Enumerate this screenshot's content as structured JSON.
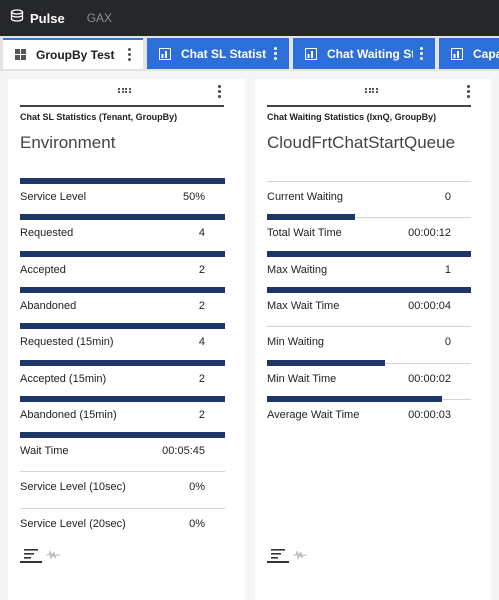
{
  "app": {
    "name": "Pulse",
    "nav": [
      "GAX"
    ]
  },
  "tabs": [
    {
      "label": "GroupBy Test",
      "active": true
    },
    {
      "label": "Chat SL Statistic…",
      "active": false
    },
    {
      "label": "Chat Waiting St…",
      "active": false
    },
    {
      "label": "Capac",
      "active": false
    }
  ],
  "widgets": [
    {
      "subtitle": "Chat SL Statistics (Tenant, GroupBy)",
      "title": "Environment",
      "rows": [
        {
          "label": "Service Level",
          "value": "50%",
          "fill": 1.0
        },
        {
          "label": "Requested",
          "value": "4",
          "fill": 1.0
        },
        {
          "label": "Accepted",
          "value": "2",
          "fill": 1.0
        },
        {
          "label": "Abandoned",
          "value": "2",
          "fill": 1.0
        },
        {
          "label": "Requested (15min)",
          "value": "4",
          "fill": 1.0
        },
        {
          "label": "Accepted (15min)",
          "value": "2",
          "fill": 1.0
        },
        {
          "label": "Abandoned (15min)",
          "value": "2",
          "fill": 1.0
        },
        {
          "label": "Wait Time",
          "value": "00:05:45",
          "fill": 1.0
        },
        {
          "label": "Service Level (10sec)",
          "value": "0%",
          "fill": 0
        },
        {
          "label": "Service Level (20sec)",
          "value": "0%",
          "fill": 0
        }
      ]
    },
    {
      "subtitle": "Chat Waiting Statistics (IxnQ, GroupBy)",
      "title": "CloudFrtChatStartQueue",
      "rows": [
        {
          "label": "Current Waiting",
          "value": "0",
          "fill": 0
        },
        {
          "label": "Total Wait Time",
          "value": "00:00:12",
          "fill": 0.43
        },
        {
          "label": "Max Waiting",
          "value": "1",
          "fill": 1.0
        },
        {
          "label": "Max Wait Time",
          "value": "00:00:04",
          "fill": 1.0
        },
        {
          "label": "Min Waiting",
          "value": "0",
          "fill": 0
        },
        {
          "label": "Min Wait Time",
          "value": "00:00:02",
          "fill": 0.58
        },
        {
          "label": "Average Wait Time",
          "value": "00:00:03",
          "fill": 0.86
        }
      ]
    }
  ],
  "colors": {
    "topbar": "#25272a",
    "tab_active_accent": "#2e7ad6",
    "tab_inactive": "#2c6fd9",
    "bar": "#1c3668"
  },
  "icons": {
    "logo": "stack-icon",
    "tab_grid": "grid-icon",
    "tab_chart": "chart-tab-icon",
    "menu": "kebab-menu-icon",
    "drag": "drag-handle-icon",
    "list_view": "list-view-icon",
    "wave_view": "waveform-icon"
  }
}
